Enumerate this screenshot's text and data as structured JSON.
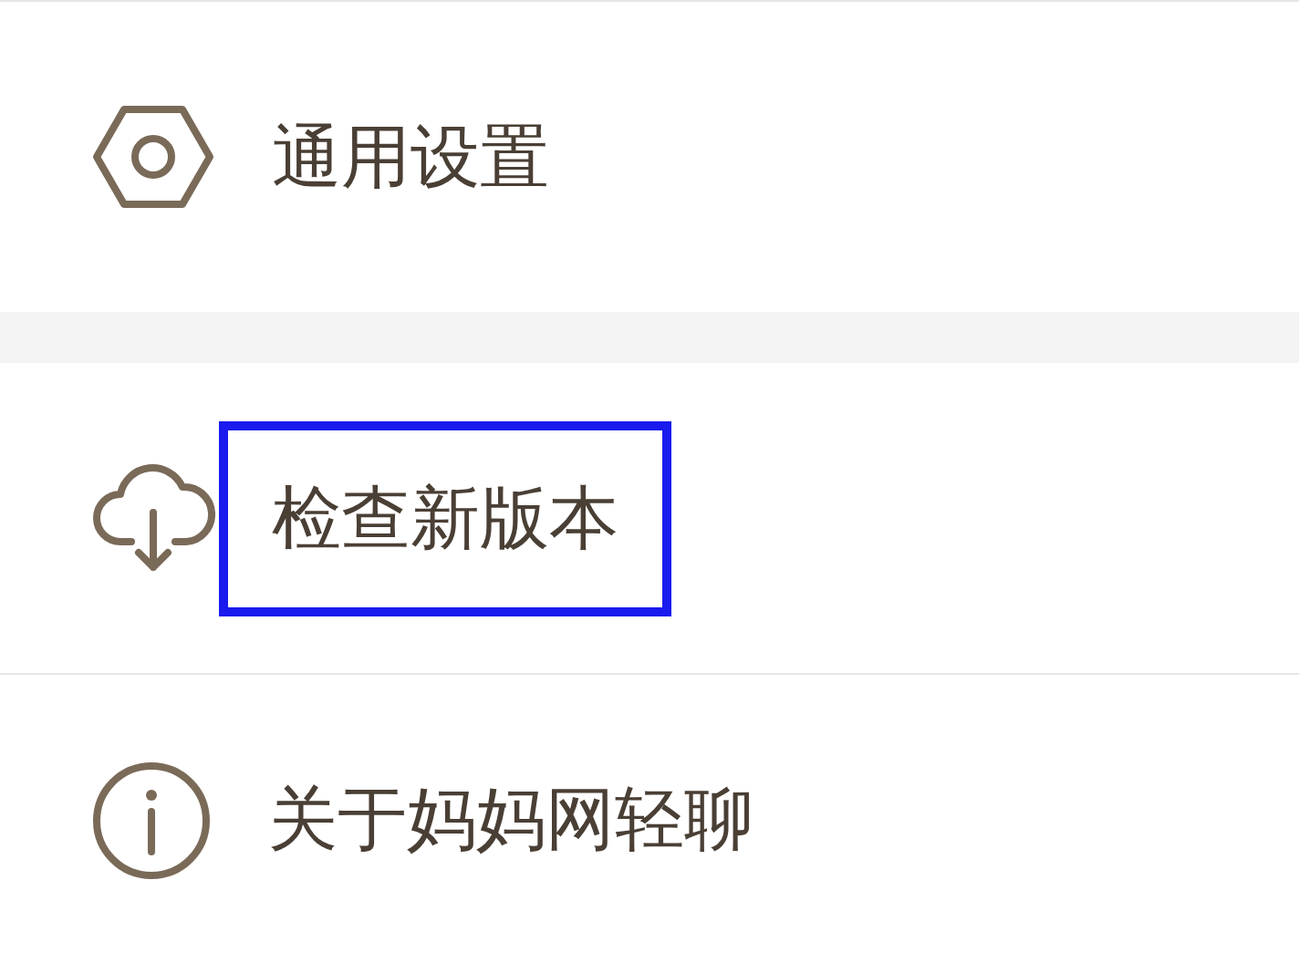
{
  "sections": [
    {
      "items": [
        {
          "kind": "settings",
          "label": "通用设置",
          "highlighted": false
        }
      ]
    },
    {
      "items": [
        {
          "kind": "update",
          "label": "检查新版本",
          "highlighted": true
        },
        {
          "kind": "about",
          "label": "关于妈妈网轻聊",
          "highlighted": false
        }
      ]
    }
  ]
}
